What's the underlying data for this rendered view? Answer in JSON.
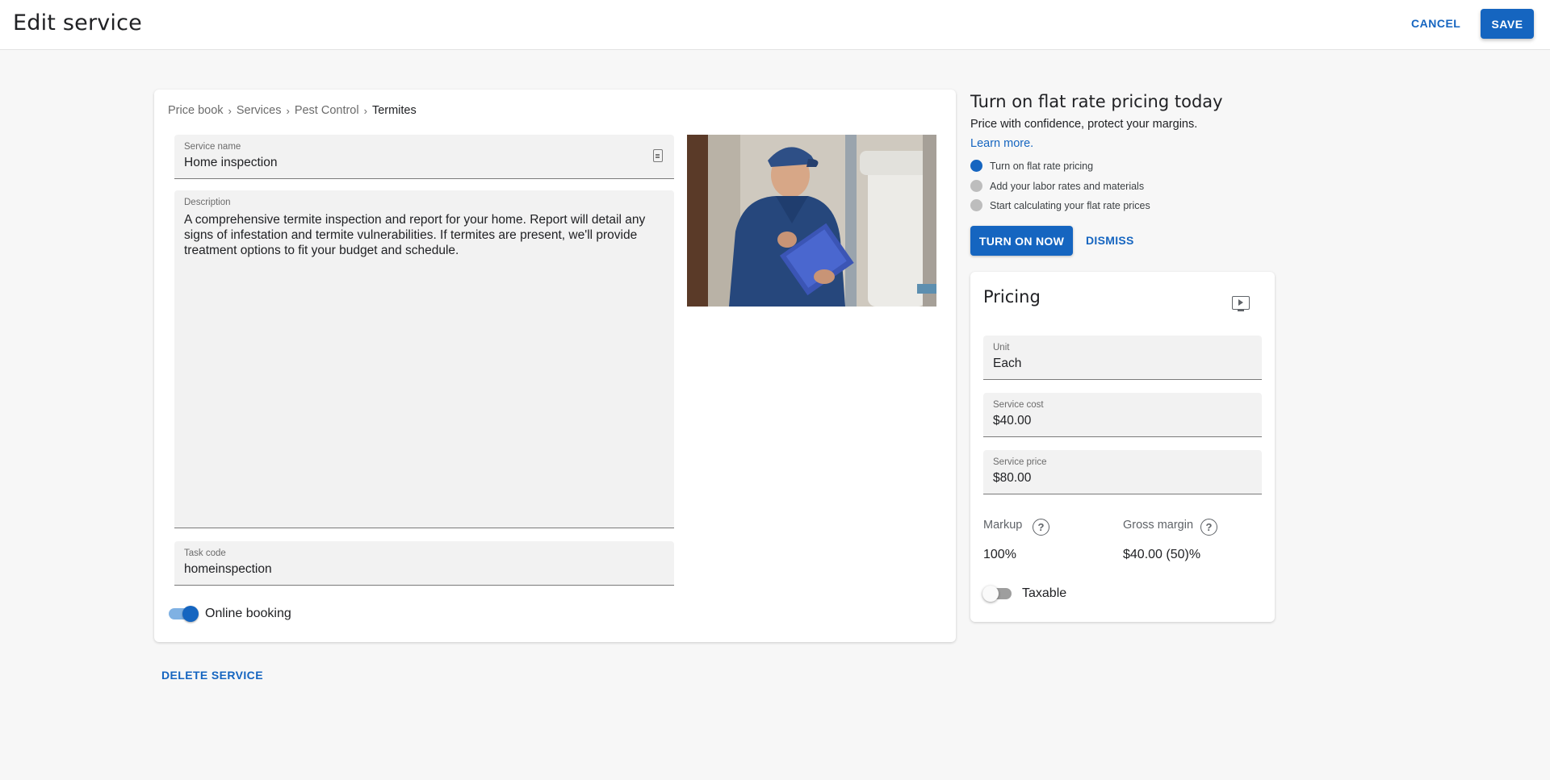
{
  "header": {
    "title": "Edit service",
    "cancel_label": "CANCEL",
    "save_label": "SAVE"
  },
  "breadcrumb": [
    "Price book",
    "Services",
    "Pest Control",
    "Termites"
  ],
  "service": {
    "name_label": "Service name",
    "name_value": "Home inspection",
    "description_label": "Description",
    "description_value": "A comprehensive termite inspection and report for your home. Report will detail any signs of infestation and termite vulnerabilities. If termites are present, we'll provide treatment options to fit your budget and schedule.",
    "task_code_label": "Task code",
    "task_code_value": "homeinspection",
    "online_booking_label": "Online booking",
    "online_booking_enabled": true,
    "delete_label": "DELETE SERVICE"
  },
  "promo": {
    "title": "Turn on flat rate pricing today",
    "subtitle": "Price with confidence, protect your margins.",
    "learn_more": "Learn more.",
    "steps": [
      {
        "label": "Turn on flat rate pricing",
        "active": true
      },
      {
        "label": "Add your labor rates and materials",
        "active": false
      },
      {
        "label": "Start calculating your flat rate prices",
        "active": false
      }
    ],
    "turn_on_label": "TURN ON NOW",
    "dismiss_label": "DISMISS"
  },
  "pricing": {
    "title": "Pricing",
    "unit_label": "Unit",
    "unit_value": "Each",
    "cost_label": "Service cost",
    "cost_value": "$40.00",
    "price_label": "Service price",
    "price_value": "$80.00",
    "markup_label": "Markup",
    "markup_value": "100%",
    "gross_margin_label": "Gross margin",
    "gross_margin_value": "$40.00 (50)%",
    "taxable_label": "Taxable",
    "taxable_enabled": false
  },
  "colors": {
    "accent": "#1565c0",
    "background": "#f7f7f7",
    "field_bg": "#f2f2f2"
  },
  "icons": [
    "document-icon",
    "video-icon",
    "help-icon",
    "chevron-right-icon"
  ]
}
